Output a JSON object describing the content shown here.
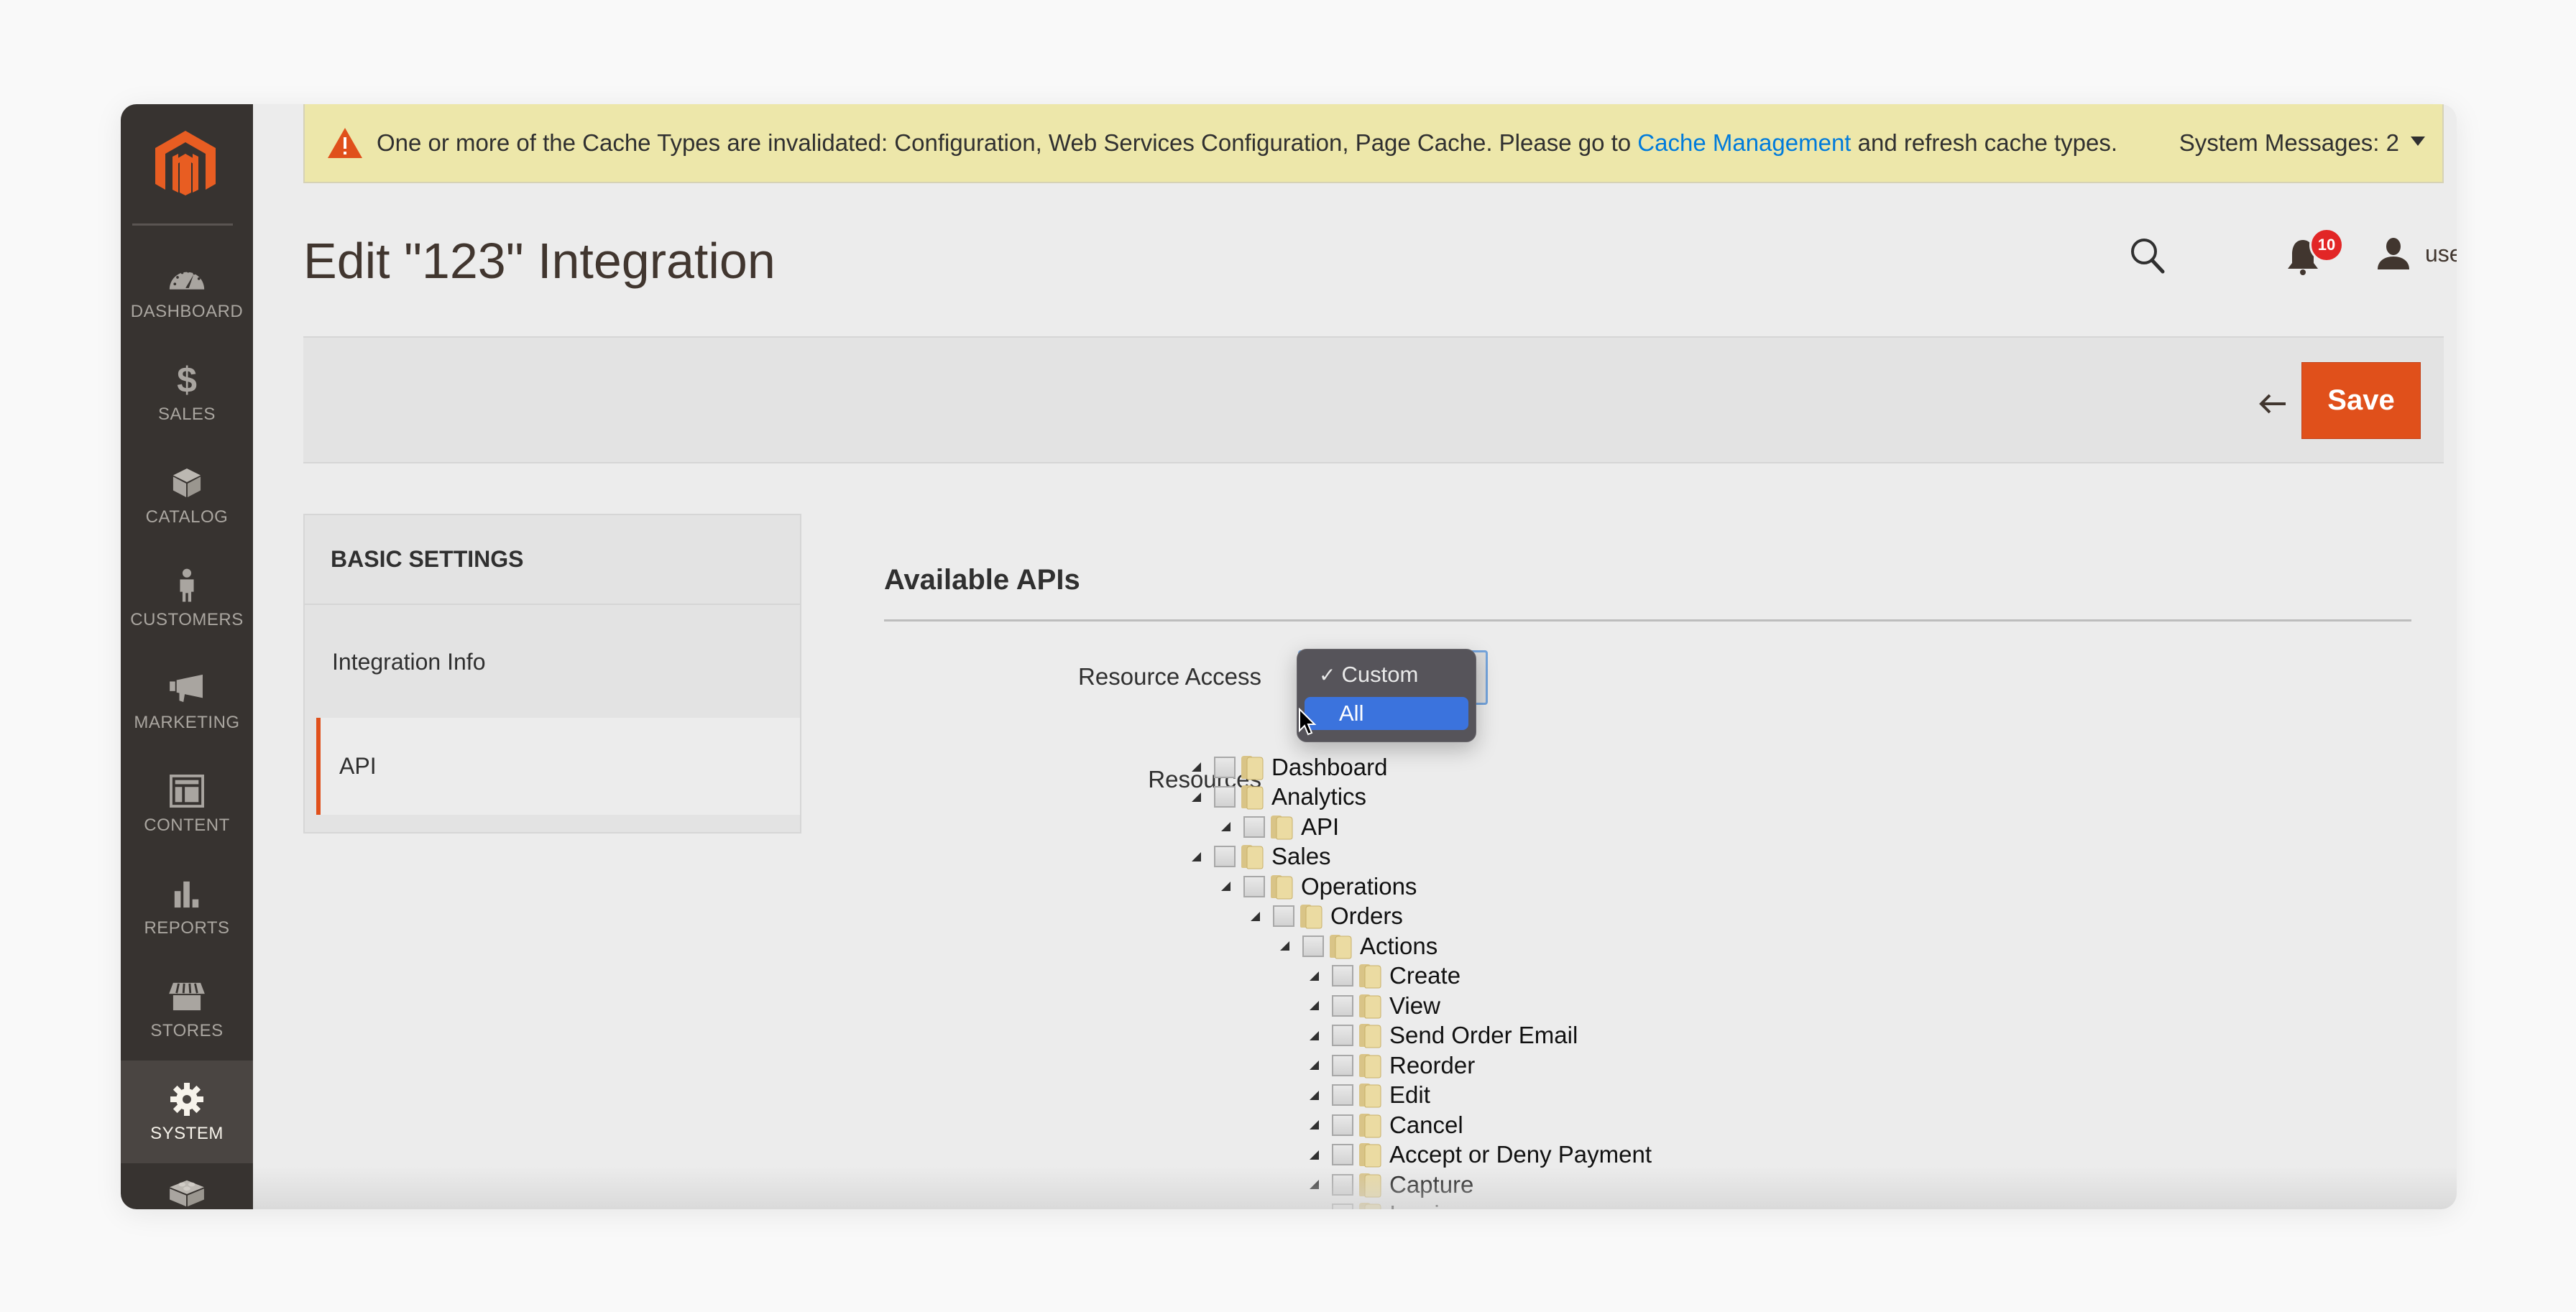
{
  "sidebar": {
    "logo": "magento-logo",
    "items": [
      {
        "label": "Dashboard",
        "icon": "dashboard-icon",
        "active": false
      },
      {
        "label": "Sales",
        "icon": "dollar-icon",
        "active": false
      },
      {
        "label": "Catalog",
        "icon": "box-icon",
        "active": false
      },
      {
        "label": "Customers",
        "icon": "person-icon",
        "active": false
      },
      {
        "label": "Marketing",
        "icon": "megaphone-icon",
        "active": false
      },
      {
        "label": "Content",
        "icon": "layout-icon",
        "active": false
      },
      {
        "label": "Reports",
        "icon": "bar-chart-icon",
        "active": false
      },
      {
        "label": "Stores",
        "icon": "storefront-icon",
        "active": false
      },
      {
        "label": "System",
        "icon": "gear-icon",
        "active": true
      },
      {
        "label": "",
        "icon": "lego-block-icon",
        "active": false
      }
    ]
  },
  "notice": {
    "text_before": "One or more of the Cache Types are invalidated: Configuration, Web Services Configuration, Page Cache. Please go to ",
    "link": "Cache Management",
    "text_after": " and refresh cache types.",
    "system_messages": "System Messages: 2",
    "colors": {
      "background": "#ede7aa",
      "link": "#007bdb",
      "warning": "#e0501b"
    }
  },
  "header": {
    "title": "Edit \"123\" Integration",
    "notifications_count": "10",
    "user_name": "user"
  },
  "actions": {
    "back_label": "Back",
    "save_label": "Save",
    "save_color": "#e0501b"
  },
  "tabs": {
    "title": "BASIC SETTINGS",
    "items": [
      {
        "label": "Integration Info",
        "active": false
      },
      {
        "label": "API",
        "active": true
      }
    ]
  },
  "api_section": {
    "title": "Available APIs",
    "resource_access_label": "Resource Access",
    "resources_label": "Resources",
    "dropdown": {
      "options": [
        {
          "label": "Custom",
          "checked": true,
          "highlighted": false
        },
        {
          "label": "All",
          "checked": false,
          "highlighted": true
        }
      ],
      "highlight_color": "#3b73dd"
    },
    "tree": [
      {
        "label": "Dashboard",
        "level": 0
      },
      {
        "label": "Analytics",
        "level": 0
      },
      {
        "label": "API",
        "level": 1
      },
      {
        "label": "Sales",
        "level": 0
      },
      {
        "label": "Operations",
        "level": 1
      },
      {
        "label": "Orders",
        "level": 2
      },
      {
        "label": "Actions",
        "level": 3
      },
      {
        "label": "Create",
        "level": 4
      },
      {
        "label": "View",
        "level": 4
      },
      {
        "label": "Send Order Email",
        "level": 4
      },
      {
        "label": "Reorder",
        "level": 4
      },
      {
        "label": "Edit",
        "level": 4
      },
      {
        "label": "Cancel",
        "level": 4
      },
      {
        "label": "Accept or Deny Payment",
        "level": 4
      },
      {
        "label": "Capture",
        "level": 4
      },
      {
        "label": "Invoice",
        "level": 4
      }
    ]
  }
}
